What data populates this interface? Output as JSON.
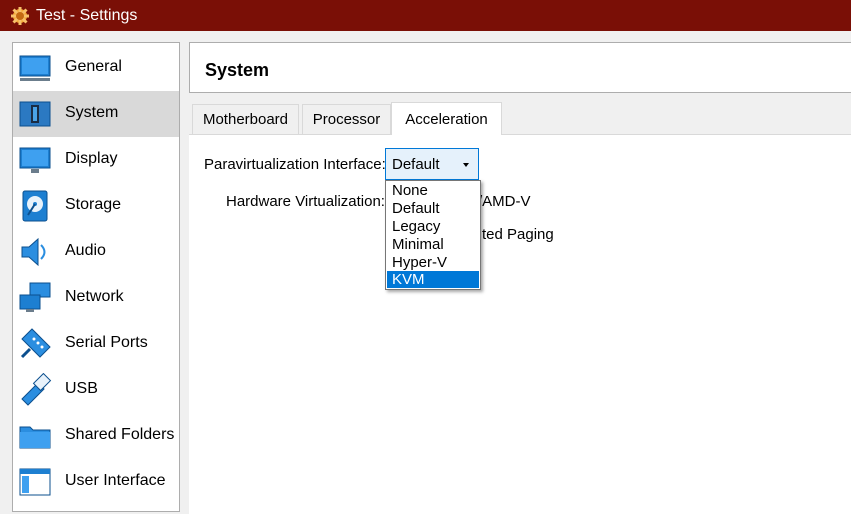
{
  "window": {
    "title": "Test - Settings"
  },
  "sidebar": {
    "items": [
      {
        "label": "General",
        "icon": "general-icon"
      },
      {
        "label": "System",
        "icon": "system-icon",
        "selected": true
      },
      {
        "label": "Display",
        "icon": "display-icon"
      },
      {
        "label": "Storage",
        "icon": "storage-icon"
      },
      {
        "label": "Audio",
        "icon": "audio-icon"
      },
      {
        "label": "Network",
        "icon": "network-icon"
      },
      {
        "label": "Serial Ports",
        "icon": "serial-ports-icon"
      },
      {
        "label": "USB",
        "icon": "usb-icon"
      },
      {
        "label": "Shared Folders",
        "icon": "shared-folders-icon"
      },
      {
        "label": "User Interface",
        "icon": "user-interface-icon"
      }
    ]
  },
  "header": {
    "title": "System"
  },
  "tabs": [
    {
      "label": "Motherboard"
    },
    {
      "label": "Processor"
    },
    {
      "label": "Acceleration",
      "active": true
    }
  ],
  "acceleration": {
    "paravirt_label": "Paravirtualization Interface:",
    "paravirt_value": "Default",
    "hwvirt_label": "Hardware Virtualization:",
    "hwvirt_partial_1": "/AMD-V",
    "hwvirt_partial_2": "ted Paging"
  },
  "dropdown": {
    "options": [
      "None",
      "Default",
      "Legacy",
      "Minimal",
      "Hyper-V",
      "KVM"
    ],
    "highlighted": "KVM"
  },
  "colors": {
    "titlebar": "#7a0f06",
    "selection": "#0078d7",
    "combo_bg": "#e5f1fb"
  }
}
